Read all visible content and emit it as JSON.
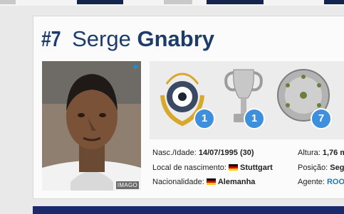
{
  "colors": {
    "accent": "#1d3c6b",
    "badge": "#3e8fdc",
    "link": "#1d7ab8"
  },
  "header": {
    "number": "#7",
    "first_name": "Serge",
    "last_name": "Gnabry"
  },
  "photo": {
    "plus_icon": "+",
    "credit": "IMAGO"
  },
  "trophies": [
    {
      "icon": "award-laurel-icon",
      "count": "1"
    },
    {
      "icon": "champions-league-trophy-icon",
      "count": "1"
    },
    {
      "icon": "bundesliga-shield-icon",
      "count": "7"
    }
  ],
  "info": {
    "birth_label": "Nasc./Idade:",
    "birth_value": "14/07/1995 (30)",
    "birthplace_label": "Local de nascimento:",
    "birthplace_value": "Stuttgart",
    "nationality_label": "Nacionalidade:",
    "nationality_value": "Alemanha",
    "height_label": "Altura:",
    "height_value": "1,76 m",
    "position_label": "Posição:",
    "position_value": "Seg",
    "agent_label": "Agente:",
    "agent_value": "ROO"
  }
}
